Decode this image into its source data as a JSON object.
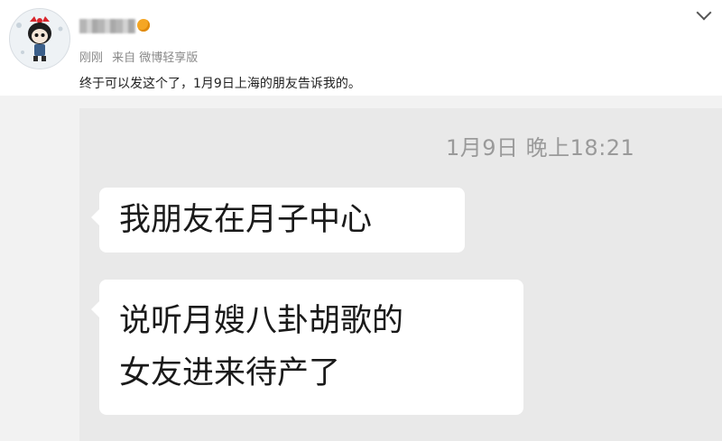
{
  "post": {
    "time": "刚刚",
    "source": "来自 微博轻享版",
    "text": "终于可以发这个了，1月9日上海的朋友告诉我的。"
  },
  "chat": {
    "timestamp": "1月9日 晚上18:21",
    "messages": [
      {
        "lines": [
          "我朋友在月子中心"
        ]
      },
      {
        "lines": [
          "说听月嫂八卦胡歌的",
          "女友进来待产了"
        ]
      }
    ]
  }
}
